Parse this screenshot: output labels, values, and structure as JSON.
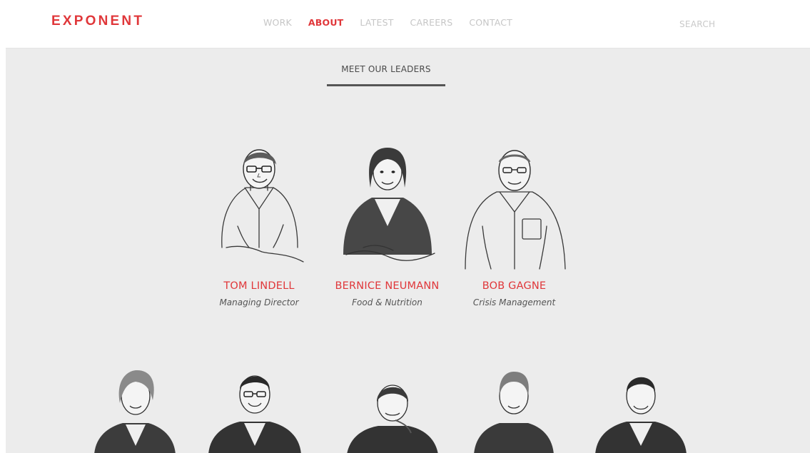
{
  "header": {
    "logo": "EXPONENT",
    "nav": [
      "WORK",
      "ABOUT",
      "LATEST",
      "CAREERS",
      "CONTACT"
    ],
    "active_nav": "ABOUT",
    "search": "SEARCH"
  },
  "section": {
    "title": "MEET OUR LEADERS"
  },
  "leaders": [
    {
      "name": "TOM LINDELL",
      "role": "Managing Director"
    },
    {
      "name": "BERNICE NEUMANN",
      "role": "Food & Nutrition"
    },
    {
      "name": "BOB GAGNE",
      "role": "Crisis Management"
    }
  ],
  "colors": {
    "accent": "#e0373a",
    "background": "#ececec",
    "header_bg": "#ffffff",
    "nav_inactive": "#c6c6c6",
    "text_dark": "#4a4a4a"
  }
}
